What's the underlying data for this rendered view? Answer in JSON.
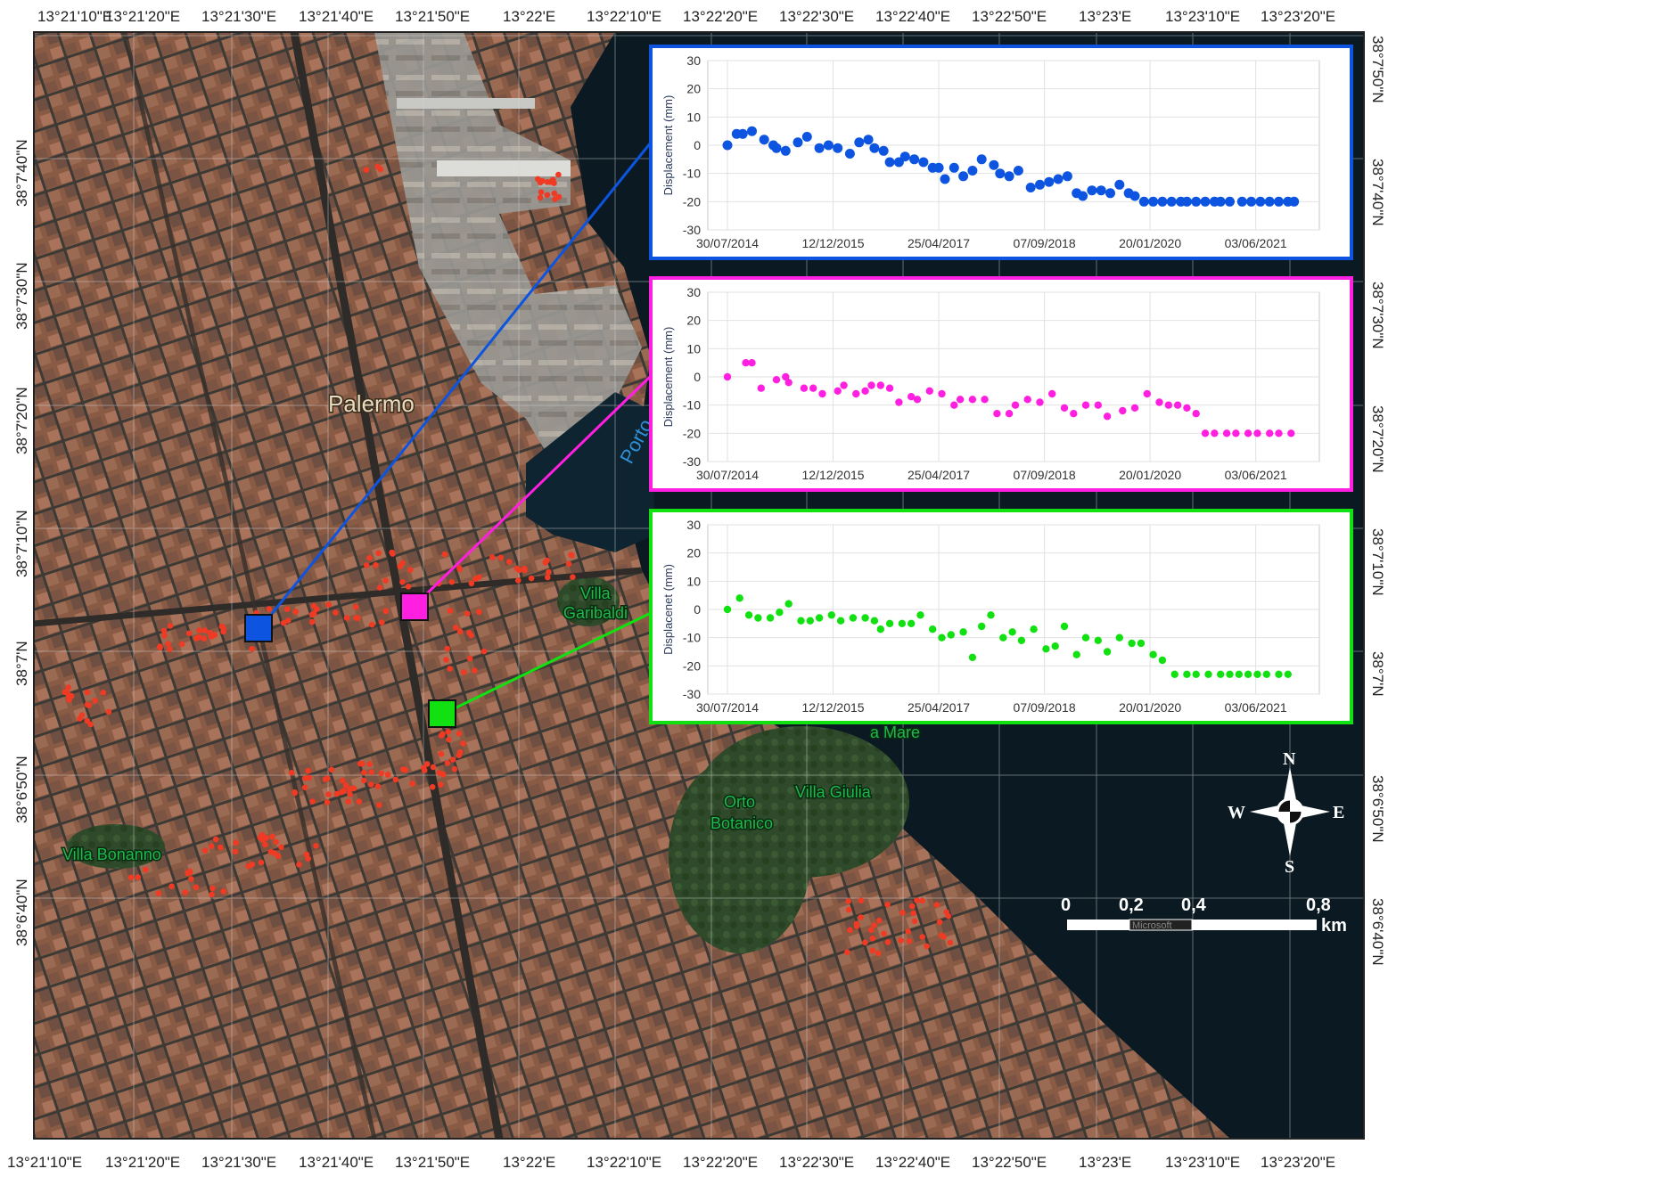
{
  "map": {
    "top_lon_labels": [
      "13°21'10\"E",
      "13°21'20\"E",
      "13°21'30\"E",
      "13°21'40\"E",
      "13°21'50\"E",
      "13°22'E",
      "13°22'10\"E",
      "13°22'20\"E",
      "13°22'30\"E",
      "13°22'40\"E",
      "13°22'50\"E",
      "13°23'E",
      "13°23'10\"E",
      "13°23'20\"E"
    ],
    "bottom_lon_labels": [
      "13°21'10\"E",
      "13°21'20\"E",
      "13°21'30\"E",
      "13°21'40\"E",
      "13°21'50\"E",
      "13°22'E",
      "13°22'10\"E",
      "13°22'20\"E",
      "13°22'30\"E",
      "13°22'40\"E",
      "13°22'50\"E",
      "13°23'E",
      "13°23'10\"E",
      "13°23'20\"E"
    ],
    "lat_labels": [
      "38°7'50\"N",
      "38°7'40\"N",
      "38°7'30\"N",
      "38°7'20\"N",
      "38°7'10\"N",
      "38°7'N",
      "38°6'50\"N",
      "38°6'40\"N"
    ],
    "place_labels": {
      "palermo": "Palermo",
      "porto": "Porto",
      "villa_garibaldi_1": "Villa",
      "villa_garibaldi_2": "Garibaldi",
      "a_mare": "a Mare",
      "orto_botanico_1": "Orto",
      "orto_botanico_2": "Botanico",
      "villa_giulia": "Villa Giulia",
      "villa_bonanno": "Villa Bonanno"
    },
    "compass": {
      "n": "N",
      "s": "S",
      "e": "E",
      "w": "W"
    },
    "scale_bar": {
      "ticks": [
        "0",
        "0,2",
        "0,4",
        "0,8"
      ],
      "unit": "km",
      "attribution": "Microsoft"
    },
    "colors": {
      "blue": "#0d55e0",
      "magenta": "#ff1fe0",
      "green": "#11e011",
      "ps_points": "#f03a24",
      "sea": "#0b1a22"
    }
  },
  "chart_data": [
    {
      "type": "scatter",
      "color": "#0d55e0",
      "ylabel": "Displacement (mm)",
      "ylim": [
        -30,
        30
      ],
      "yticks": [
        "30",
        "20",
        "10",
        "0",
        "-10",
        "-20",
        "-30"
      ],
      "xticks": [
        "30/07/2014",
        "12/12/2015",
        "25/04/2017",
        "07/09/2018",
        "20/01/2020",
        "03/06/2021"
      ],
      "x_index": [
        0.0,
        0.3,
        0.5,
        0.8,
        1.2,
        1.5,
        1.6,
        1.9,
        2.3,
        2.6,
        3.0,
        3.3,
        3.6,
        4.0,
        4.3,
        4.6,
        4.8,
        5.1,
        5.3,
        5.6,
        5.8,
        6.1,
        6.4,
        6.7,
        6.9,
        7.1,
        7.4,
        7.7,
        8.0,
        8.3,
        8.7,
        8.9,
        9.2,
        9.5,
        9.9,
        10.2,
        10.5,
        10.8,
        11.1,
        11.4,
        11.6,
        11.9,
        12.2,
        12.5,
        12.8,
        13.1,
        13.3,
        13.6,
        13.9,
        14.2,
        14.5,
        14.8,
        15.0,
        15.3,
        15.6,
        15.9,
        16.1,
        16.4,
        16.8,
        17.1,
        17.4,
        17.7,
        18.0,
        18.3,
        18.5
      ],
      "values": [
        0,
        4,
        4,
        5,
        2,
        0,
        -1,
        -2,
        1,
        3,
        -1,
        0,
        -1,
        -3,
        1,
        2,
        -1,
        -2,
        -6,
        -6,
        -4,
        -5,
        -6,
        -8,
        -8,
        -12,
        -8,
        -11,
        -9,
        -5,
        -7,
        -10,
        -11,
        -9,
        -15,
        -14,
        -13,
        -12,
        -11,
        -17,
        -18,
        -16,
        -16,
        -17,
        -14,
        -17,
        -18,
        -20,
        -20,
        -20,
        -20,
        -20,
        -20,
        -20,
        -20,
        -20,
        -20,
        -20,
        -20,
        -20,
        -20,
        -20,
        -20,
        -20,
        -20
      ]
    },
    {
      "type": "scatter",
      "color": "#ff1fe0",
      "ylabel": "Displacement (mm)",
      "ylim": [
        -30,
        30
      ],
      "yticks": [
        "30",
        "20",
        "10",
        "0",
        "-10",
        "-20",
        "-30"
      ],
      "xticks": [
        "30/07/2014",
        "12/12/2015",
        "25/04/2017",
        "07/09/2018",
        "20/01/2020",
        "03/06/2021"
      ],
      "x_index": [
        0.0,
        0.6,
        0.8,
        1.1,
        1.6,
        1.9,
        2.0,
        2.5,
        2.8,
        3.1,
        3.6,
        3.8,
        4.2,
        4.5,
        4.7,
        5.0,
        5.3,
        5.6,
        6.0,
        6.2,
        6.6,
        7.0,
        7.4,
        7.6,
        8.0,
        8.4,
        8.8,
        9.2,
        9.4,
        9.8,
        10.2,
        10.6,
        11.0,
        11.3,
        11.7,
        12.1,
        12.4,
        12.9,
        13.3,
        13.7,
        14.1,
        14.4,
        14.7,
        15.0,
        15.3,
        15.6,
        15.9,
        16.3,
        16.6,
        17.0,
        17.3,
        17.7,
        18.0,
        18.4
      ],
      "values": [
        0,
        5,
        5,
        -4,
        -1,
        0,
        -2,
        -4,
        -4,
        -6,
        -5,
        -3,
        -6,
        -5,
        -3,
        -3,
        -4,
        -9,
        -7,
        -8,
        -5,
        -6,
        -10,
        -8,
        -8,
        -8,
        -13,
        -13,
        -10,
        -8,
        -9,
        -6,
        -11,
        -13,
        -10,
        -10,
        -14,
        -12,
        -11,
        -6,
        -9,
        -10,
        -10,
        -11,
        -13,
        -20,
        -20,
        -20,
        -20,
        -20,
        -20,
        -20,
        -20,
        -20
      ]
    },
    {
      "type": "scatter",
      "color": "#11e011",
      "ylabel": "Displacenet (mm)",
      "ylim": [
        -30,
        30
      ],
      "yticks": [
        "30",
        "20",
        "10",
        "0",
        "-10",
        "-20",
        "-30"
      ],
      "xticks": [
        "30/07/2014",
        "12/12/2015",
        "25/04/2017",
        "07/09/2018",
        "20/01/2020",
        "03/06/2021"
      ],
      "x_index": [
        0.0,
        0.4,
        0.7,
        1.0,
        1.4,
        1.7,
        2.0,
        2.4,
        2.7,
        3.0,
        3.4,
        3.7,
        4.1,
        4.5,
        4.8,
        5.0,
        5.3,
        5.7,
        6.0,
        6.3,
        6.7,
        7.0,
        7.3,
        7.7,
        8.0,
        8.3,
        8.6,
        9.0,
        9.3,
        9.6,
        10.0,
        10.4,
        10.7,
        11.0,
        11.4,
        11.7,
        12.1,
        12.4,
        12.8,
        13.2,
        13.5,
        13.9,
        14.2,
        14.6,
        15.0,
        15.3,
        15.7,
        16.1,
        16.4,
        16.7,
        17.0,
        17.3,
        17.6,
        18.0,
        18.3
      ],
      "values": [
        0,
        4,
        -2,
        -3,
        -3,
        -1,
        2,
        -4,
        -4,
        -3,
        -2,
        -4,
        -3,
        -3,
        -4,
        -7,
        -5,
        -5,
        -5,
        -2,
        -7,
        -10,
        -9,
        -8,
        -17,
        -6,
        -2,
        -10,
        -8,
        -11,
        -7,
        -14,
        -13,
        -6,
        -16,
        -10,
        -11,
        -15,
        -10,
        -12,
        -12,
        -16,
        -18,
        -23,
        -23,
        -23,
        -23,
        -23,
        -23,
        -23,
        -23,
        -23,
        -23,
        -23,
        -23
      ]
    }
  ]
}
